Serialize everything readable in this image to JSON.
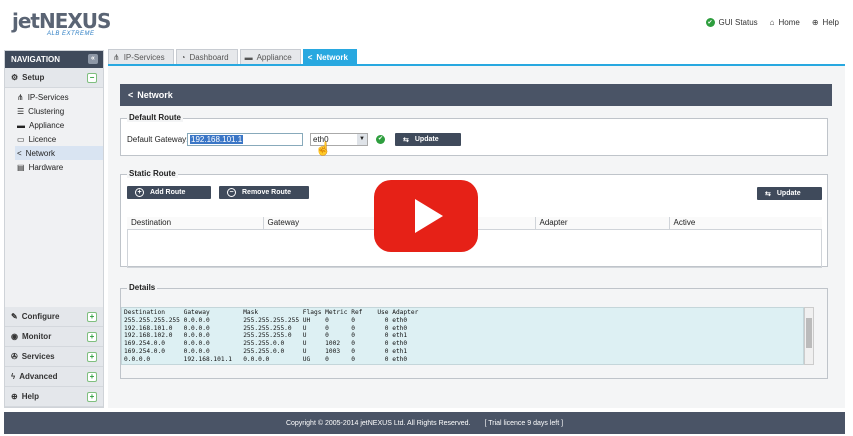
{
  "header": {
    "logo_text": "jetNEXUS",
    "logo_sub": "ALB EXTREME",
    "links": [
      {
        "icon": "status-icon",
        "label": "GUI Status"
      },
      {
        "icon": "home-icon",
        "label": "Home"
      },
      {
        "icon": "lifebuoy-icon",
        "label": "Help"
      }
    ]
  },
  "sidebar": {
    "title": "NAVIGATION",
    "setup_label": "Setup",
    "setup_items": [
      {
        "label": "IP-Services",
        "icon": "network-icon"
      },
      {
        "label": "Clustering",
        "icon": "cluster-icon"
      },
      {
        "label": "Appliance",
        "icon": "appliance-icon"
      },
      {
        "label": "Licence",
        "icon": "licence-icon"
      },
      {
        "label": "Network",
        "icon": "share-icon",
        "active": true
      },
      {
        "label": "Hardware",
        "icon": "hardware-icon"
      }
    ],
    "sections": [
      {
        "label": "Configure",
        "icon": "configure-icon"
      },
      {
        "label": "Monitor",
        "icon": "monitor-icon"
      },
      {
        "label": "Services",
        "icon": "services-icon"
      },
      {
        "label": "Advanced",
        "icon": "advanced-icon"
      },
      {
        "label": "Help",
        "icon": "help-icon"
      }
    ]
  },
  "tabs": [
    {
      "label": "IP-Services",
      "active": false
    },
    {
      "label": "Dashboard",
      "active": false
    },
    {
      "label": "Appliance",
      "active": false
    },
    {
      "label": "Network",
      "active": true
    }
  ],
  "page": {
    "title": "Network",
    "default_route": {
      "legend": "Default Route",
      "gateway_label": "Default Gateway:",
      "gateway_value": "192.168.101.1",
      "adapter_value": "eth0",
      "update_label": "Update"
    },
    "static_route": {
      "legend": "Static Route",
      "add_label": "Add Route",
      "remove_label": "Remove Route",
      "update_label": "Update",
      "columns": [
        "Destination",
        "Gateway",
        "",
        "Adapter",
        "Active"
      ]
    },
    "details": {
      "legend": "Details",
      "text": "Destination     Gateway         Mask            Flags Metric Ref    Use Adapter\n255.255.255.255 0.0.0.0         255.255.255.255 UH    0      0        0 eth0\n192.168.101.0   0.0.0.0         255.255.255.0   U     0      0        0 eth0\n192.168.102.0   0.0.0.0         255.255.255.0   U     0      0        0 eth1\n169.254.0.0     0.0.0.0         255.255.0.0     U     1002   0        0 eth0\n169.254.0.0     0.0.0.0         255.255.0.0     U     1003   0        0 eth1\n0.0.0.0         192.168.101.1   0.0.0.0         UG    0      0        0 eth0"
    }
  },
  "footer": {
    "copyright": "Copyright © 2005-2014 jetNEXUS Ltd. All Rights Reserved.",
    "licence": "[ Trial licence 9 days left ]"
  },
  "colors": {
    "accent": "#28a8e0",
    "dark": "#4a5466",
    "play": "#e62117"
  }
}
